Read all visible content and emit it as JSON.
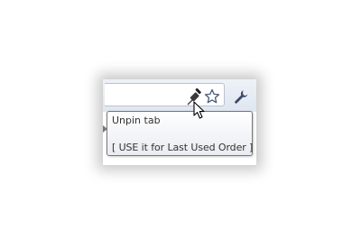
{
  "toolbar": {
    "icons": [
      "pin-icon",
      "star-icon",
      "wrench-icon"
    ]
  },
  "tooltip": {
    "title": "Unpin tab",
    "hint": "[ USE  it for Last Used Order ]"
  },
  "colors": {
    "toolbar_bg": "#dfe6f0",
    "tooltip_border": "#767676",
    "text": "#333333"
  }
}
